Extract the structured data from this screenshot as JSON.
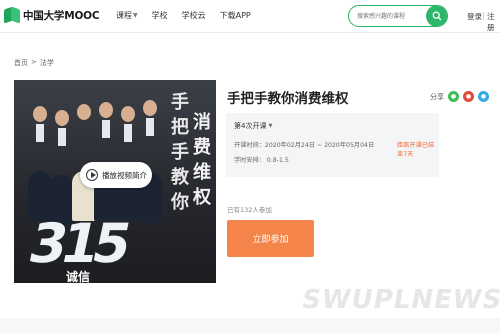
{
  "header": {
    "logo_text": "中国大学MOOC",
    "nav": [
      {
        "label": "课程",
        "has_caret": true
      },
      {
        "label": "学校",
        "has_caret": false
      },
      {
        "label": "学校云",
        "has_caret": false
      },
      {
        "label": "下载APP",
        "has_caret": false
      }
    ],
    "search_placeholder": "搜索感兴趣的课程",
    "login_label": "登录",
    "register_label": "注册"
  },
  "breadcrumb": [
    "首页",
    ">",
    "法学"
  ],
  "cover": {
    "play_label": "播放视频简介",
    "big_text": "315",
    "sub_text": "诚信",
    "vertical_left": [
      "手",
      "把",
      "手",
      "教",
      "你"
    ],
    "vertical_right": [
      "消",
      "费",
      "维",
      "权"
    ]
  },
  "course": {
    "title": "手把手教你消费维权",
    "share_label": "分享",
    "session_label": "第4次开课",
    "date_text": "开课时间：2020年02月24日 ~ 2020年05月04日",
    "ended_text": "距离开课已结束7天",
    "load_text": "学时安排：  0.8-1.5",
    "joined_text": "已有132人参加",
    "join_label": "立即参加"
  },
  "watermark": "SWUPLNEWS",
  "colors": {
    "brand_green": "#2bb66b",
    "accent_orange": "#f4844a",
    "ended_red": "#ee6b3a"
  },
  "icons": {
    "search": "search-icon",
    "play": "play-icon",
    "wechat": "wechat-icon",
    "weibo": "weibo-icon",
    "qq": "qq-icon"
  }
}
